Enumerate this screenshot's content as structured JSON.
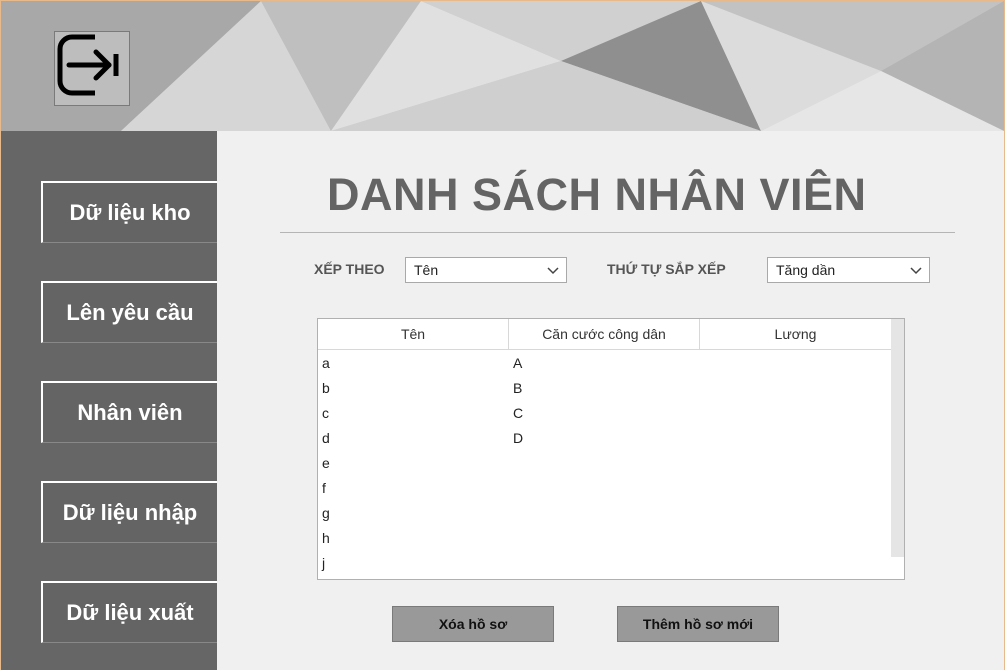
{
  "header": {
    "logout_icon": "logout-arrow-icon"
  },
  "sidebar": {
    "items": [
      {
        "label": "Dữ liệu kho"
      },
      {
        "label": "Lên yêu cầu"
      },
      {
        "label": "Nhân viên"
      },
      {
        "label": "Dữ liệu nhập"
      },
      {
        "label": "Dữ liệu xuất"
      }
    ]
  },
  "main": {
    "title": "DANH SÁCH NHÂN VIÊN",
    "sort_by_label": "XẾP THEO",
    "sort_by_value": "Tên",
    "sort_order_label": "THỨ TỰ SẮP XẾP",
    "sort_order_value": "Tăng dần",
    "table": {
      "columns": [
        "Tên",
        "Căn cước công dân",
        "Lương"
      ],
      "rows": [
        [
          "a",
          "A",
          ""
        ],
        [
          "b",
          "B",
          ""
        ],
        [
          "c",
          "C",
          ""
        ],
        [
          "d",
          "D",
          ""
        ],
        [
          "e",
          "",
          ""
        ],
        [
          "f",
          "",
          ""
        ],
        [
          "g",
          "",
          ""
        ],
        [
          "h",
          "",
          ""
        ],
        [
          "j",
          "",
          ""
        ]
      ]
    },
    "delete_button": "Xóa hồ sơ",
    "add_button": "Thêm hồ sơ mới"
  },
  "colors": {
    "sidebar": "#666666",
    "title": "#646464",
    "button": "#999999",
    "window_border": "#e8b98a"
  }
}
